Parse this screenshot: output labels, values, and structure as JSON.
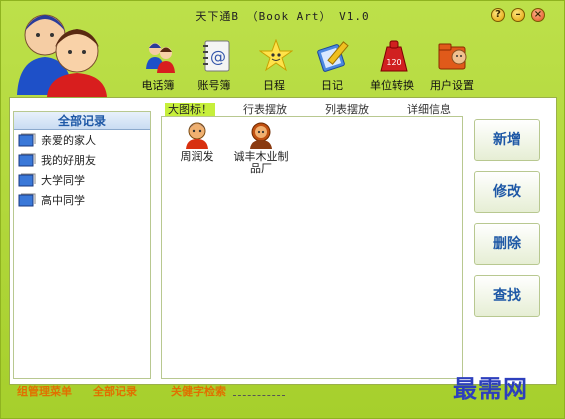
{
  "window": {
    "title": "天下通B （Book Art） V1.0"
  },
  "title_buttons": {
    "help": "?",
    "minimize": "–",
    "close": "×"
  },
  "toolbar": {
    "items": [
      {
        "label": "电话簿",
        "icon": "people-icon"
      },
      {
        "label": "账号簿",
        "icon": "notebook-at-icon"
      },
      {
        "label": "日程",
        "icon": "star-face-icon"
      },
      {
        "label": "日记",
        "icon": "diary-pen-icon"
      },
      {
        "label": "单位转换",
        "icon": "weight-120-icon"
      },
      {
        "label": "用户设置",
        "icon": "user-folder-icon"
      }
    ]
  },
  "sidebar": {
    "header": "全部记录",
    "groups": [
      "亲爱的家人",
      "我的好朋友",
      "大学同学",
      "高中同学"
    ]
  },
  "view_tabs": [
    "大图标！",
    "行表摆放",
    "列表摆放",
    "详细信息"
  ],
  "entries": [
    {
      "name": "周润发"
    },
    {
      "name": "诚丰木业制品厂"
    }
  ],
  "actions": {
    "add": "新增",
    "edit": "修改",
    "delete": "删除",
    "find": "查找"
  },
  "footer": {
    "group_menu": "组管理菜单",
    "all_records": "全部记录",
    "keyword_search": "关健字检索",
    "keyword_value": ""
  },
  "watermark": "最需网",
  "colors": {
    "window_green": "#a6cf2c",
    "accent_blue": "#1e58a6",
    "footer_orange": "#e07000",
    "active_tab": "#c6ef3b"
  }
}
